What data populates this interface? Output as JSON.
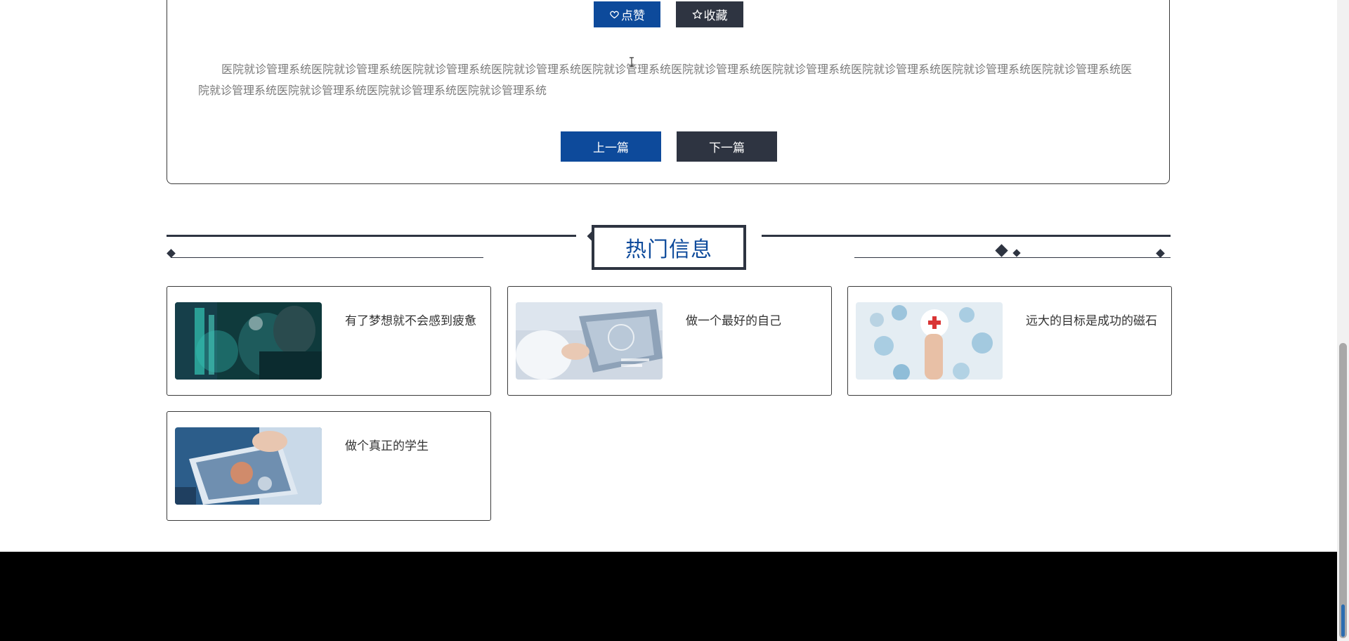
{
  "article": {
    "like_label": "点赞",
    "favorite_label": "收藏",
    "body": "医院就诊管理系统医院就诊管理系统医院就诊管理系统医院就诊管理系统医院就诊管理系统医院就诊管理系统医院就诊管理系统医院就诊管理系统医院就诊管理系统医院就诊管理系统医院就诊管理系统医院就诊管理系统医院就诊管理系统医院就诊管理系统",
    "prev_label": "上一篇",
    "next_label": "下一篇"
  },
  "hot_section": {
    "title": "热门信息",
    "items": [
      {
        "title": "有了梦想就不会感到疲惫",
        "image": "surgery-teal-photo"
      },
      {
        "title": "做一个最好的自己",
        "image": "tablet-hand-photo"
      },
      {
        "title": "远大的目标是成功的磁石",
        "image": "medical-icons-hand-photo"
      },
      {
        "title": "做个真正的学生",
        "image": "tablet-doctor-photo"
      }
    ]
  },
  "colors": {
    "primary_blue": "#0d4a9b",
    "dark_slate": "#2e3441",
    "footer": "#000000"
  }
}
